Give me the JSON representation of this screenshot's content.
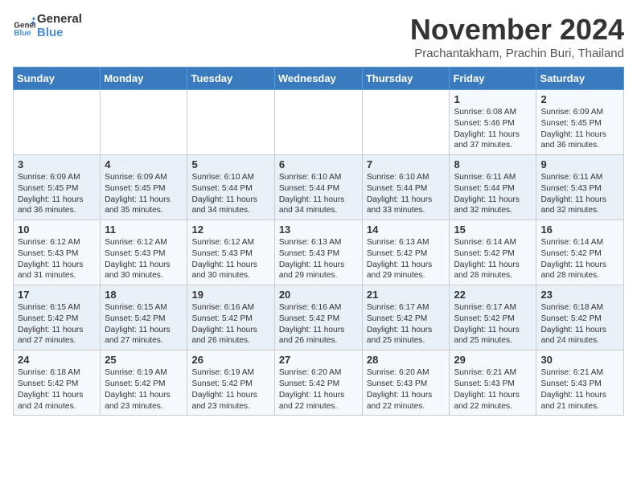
{
  "header": {
    "logo_line1": "General",
    "logo_line2": "Blue",
    "month": "November 2024",
    "location": "Prachantakham, Prachin Buri, Thailand"
  },
  "weekdays": [
    "Sunday",
    "Monday",
    "Tuesday",
    "Wednesday",
    "Thursday",
    "Friday",
    "Saturday"
  ],
  "weeks": [
    [
      {
        "day": "",
        "text": ""
      },
      {
        "day": "",
        "text": ""
      },
      {
        "day": "",
        "text": ""
      },
      {
        "day": "",
        "text": ""
      },
      {
        "day": "",
        "text": ""
      },
      {
        "day": "1",
        "text": "Sunrise: 6:08 AM\nSunset: 5:46 PM\nDaylight: 11 hours and 37 minutes."
      },
      {
        "day": "2",
        "text": "Sunrise: 6:09 AM\nSunset: 5:45 PM\nDaylight: 11 hours and 36 minutes."
      }
    ],
    [
      {
        "day": "3",
        "text": "Sunrise: 6:09 AM\nSunset: 5:45 PM\nDaylight: 11 hours and 36 minutes."
      },
      {
        "day": "4",
        "text": "Sunrise: 6:09 AM\nSunset: 5:45 PM\nDaylight: 11 hours and 35 minutes."
      },
      {
        "day": "5",
        "text": "Sunrise: 6:10 AM\nSunset: 5:44 PM\nDaylight: 11 hours and 34 minutes."
      },
      {
        "day": "6",
        "text": "Sunrise: 6:10 AM\nSunset: 5:44 PM\nDaylight: 11 hours and 34 minutes."
      },
      {
        "day": "7",
        "text": "Sunrise: 6:10 AM\nSunset: 5:44 PM\nDaylight: 11 hours and 33 minutes."
      },
      {
        "day": "8",
        "text": "Sunrise: 6:11 AM\nSunset: 5:44 PM\nDaylight: 11 hours and 32 minutes."
      },
      {
        "day": "9",
        "text": "Sunrise: 6:11 AM\nSunset: 5:43 PM\nDaylight: 11 hours and 32 minutes."
      }
    ],
    [
      {
        "day": "10",
        "text": "Sunrise: 6:12 AM\nSunset: 5:43 PM\nDaylight: 11 hours and 31 minutes."
      },
      {
        "day": "11",
        "text": "Sunrise: 6:12 AM\nSunset: 5:43 PM\nDaylight: 11 hours and 30 minutes."
      },
      {
        "day": "12",
        "text": "Sunrise: 6:12 AM\nSunset: 5:43 PM\nDaylight: 11 hours and 30 minutes."
      },
      {
        "day": "13",
        "text": "Sunrise: 6:13 AM\nSunset: 5:43 PM\nDaylight: 11 hours and 29 minutes."
      },
      {
        "day": "14",
        "text": "Sunrise: 6:13 AM\nSunset: 5:42 PM\nDaylight: 11 hours and 29 minutes."
      },
      {
        "day": "15",
        "text": "Sunrise: 6:14 AM\nSunset: 5:42 PM\nDaylight: 11 hours and 28 minutes."
      },
      {
        "day": "16",
        "text": "Sunrise: 6:14 AM\nSunset: 5:42 PM\nDaylight: 11 hours and 28 minutes."
      }
    ],
    [
      {
        "day": "17",
        "text": "Sunrise: 6:15 AM\nSunset: 5:42 PM\nDaylight: 11 hours and 27 minutes."
      },
      {
        "day": "18",
        "text": "Sunrise: 6:15 AM\nSunset: 5:42 PM\nDaylight: 11 hours and 27 minutes."
      },
      {
        "day": "19",
        "text": "Sunrise: 6:16 AM\nSunset: 5:42 PM\nDaylight: 11 hours and 26 minutes."
      },
      {
        "day": "20",
        "text": "Sunrise: 6:16 AM\nSunset: 5:42 PM\nDaylight: 11 hours and 26 minutes."
      },
      {
        "day": "21",
        "text": "Sunrise: 6:17 AM\nSunset: 5:42 PM\nDaylight: 11 hours and 25 minutes."
      },
      {
        "day": "22",
        "text": "Sunrise: 6:17 AM\nSunset: 5:42 PM\nDaylight: 11 hours and 25 minutes."
      },
      {
        "day": "23",
        "text": "Sunrise: 6:18 AM\nSunset: 5:42 PM\nDaylight: 11 hours and 24 minutes."
      }
    ],
    [
      {
        "day": "24",
        "text": "Sunrise: 6:18 AM\nSunset: 5:42 PM\nDaylight: 11 hours and 24 minutes."
      },
      {
        "day": "25",
        "text": "Sunrise: 6:19 AM\nSunset: 5:42 PM\nDaylight: 11 hours and 23 minutes."
      },
      {
        "day": "26",
        "text": "Sunrise: 6:19 AM\nSunset: 5:42 PM\nDaylight: 11 hours and 23 minutes."
      },
      {
        "day": "27",
        "text": "Sunrise: 6:20 AM\nSunset: 5:42 PM\nDaylight: 11 hours and 22 minutes."
      },
      {
        "day": "28",
        "text": "Sunrise: 6:20 AM\nSunset: 5:43 PM\nDaylight: 11 hours and 22 minutes."
      },
      {
        "day": "29",
        "text": "Sunrise: 6:21 AM\nSunset: 5:43 PM\nDaylight: 11 hours and 22 minutes."
      },
      {
        "day": "30",
        "text": "Sunrise: 6:21 AM\nSunset: 5:43 PM\nDaylight: 11 hours and 21 minutes."
      }
    ]
  ]
}
